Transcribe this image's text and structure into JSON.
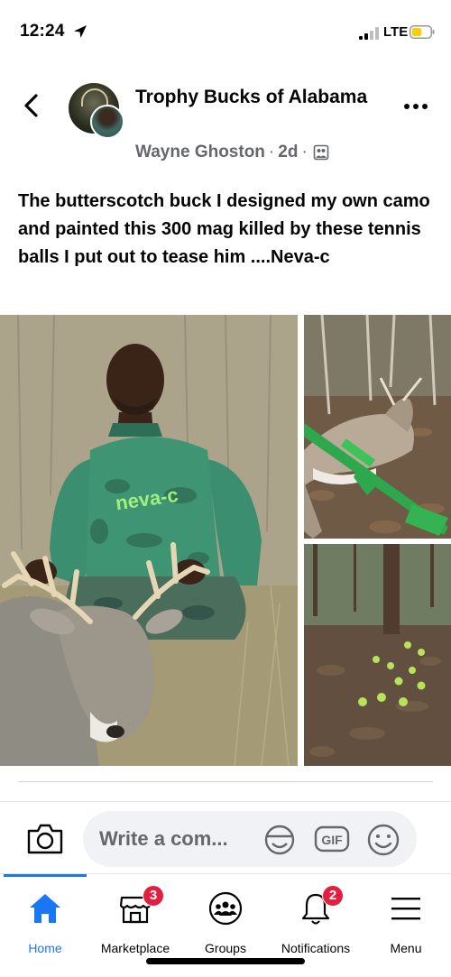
{
  "status_bar": {
    "time": "12:24",
    "network": "LTE"
  },
  "post": {
    "group_name": "Trophy Bucks of Alabama",
    "author": "Wayne Ghoston",
    "separator": "·",
    "age": "2d",
    "text": "The  butterscotch buck  I designed my own camo and painted this 300 mag killed by these tennis balls I put out to tease him ....Neva-c",
    "shirt_logo": "neva-c"
  },
  "comment": {
    "placeholder": "Write a com...",
    "gif_label": "GIF"
  },
  "tabs": [
    {
      "label": "Home",
      "badge": ""
    },
    {
      "label": "Marketplace",
      "badge": "3"
    },
    {
      "label": "Groups",
      "badge": ""
    },
    {
      "label": "Notifications",
      "badge": "2"
    },
    {
      "label": "Menu",
      "badge": ""
    }
  ],
  "colors": {
    "accent": "#1877f2",
    "badge": "#e41e3f",
    "battery": "#ffcc00",
    "meta": "#65676b"
  },
  "icons": [
    "location-arrow-icon",
    "signal-icon",
    "battery-icon",
    "back-arrow-icon",
    "more-icon",
    "privacy-icon",
    "camera-icon",
    "sticker-icon",
    "gif-icon",
    "emoji-icon",
    "home-icon",
    "marketplace-icon",
    "groups-icon",
    "bell-icon",
    "menu-icon"
  ]
}
